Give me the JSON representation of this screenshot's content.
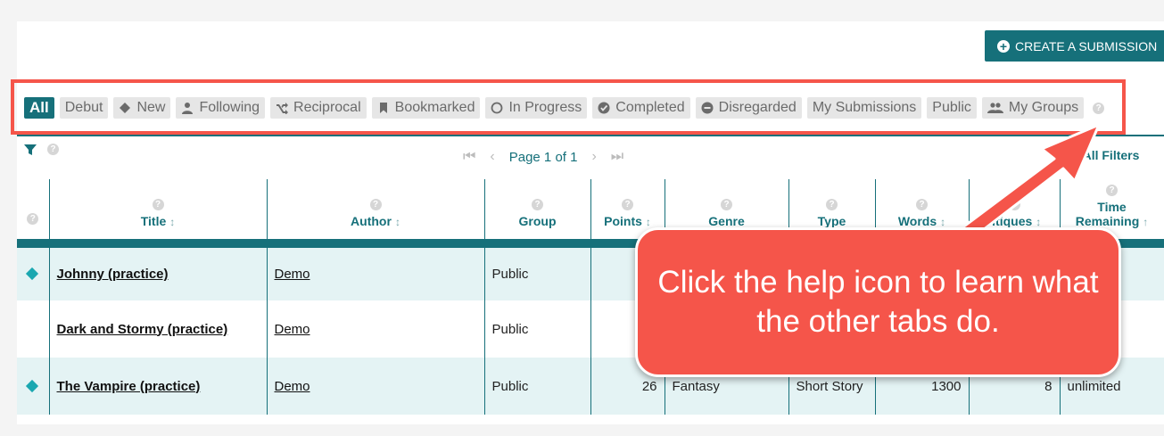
{
  "header": {
    "create_button_label": "CREATE A SUBMISSION"
  },
  "tabs": [
    {
      "label": "All",
      "icon": ""
    },
    {
      "label": "Debut",
      "icon": ""
    },
    {
      "label": "New",
      "icon": "diamond-icon"
    },
    {
      "label": "Following",
      "icon": "person-icon"
    },
    {
      "label": "Reciprocal",
      "icon": "shuffle-icon"
    },
    {
      "label": "Bookmarked",
      "icon": "bookmark-icon"
    },
    {
      "label": "In Progress",
      "icon": "circle-outline-icon"
    },
    {
      "label": "Completed",
      "icon": "check-circle-icon"
    },
    {
      "label": "Disregarded",
      "icon": "minus-circle-icon"
    },
    {
      "label": "My Submissions",
      "icon": ""
    },
    {
      "label": "Public",
      "icon": ""
    },
    {
      "label": "My Groups",
      "icon": "group-icon"
    }
  ],
  "help_glyph": "?",
  "pager": {
    "first": "⏮",
    "prev": "‹",
    "label": "Page 1 of 1",
    "next": "›",
    "last": "⏭"
  },
  "clear_filters": "ar All Filters",
  "columns": [
    "",
    "Title",
    "Author",
    "Group",
    "Points",
    "Genre",
    "Type",
    "Words",
    "Critiques",
    "Time Remaining"
  ],
  "column_labels_visible": {
    "genre": "Genre",
    "type": "Type",
    "words": "Words",
    "critiques": "ritiques",
    "time_remaining": "Time Remaining"
  },
  "rows": [
    {
      "marker": "diamond",
      "title": "Johnny (practice)",
      "author": "Demo",
      "group": "Public",
      "points": "",
      "genre": "",
      "type": "",
      "words": "",
      "critiques": "",
      "time": ""
    },
    {
      "marker": "",
      "title": "Dark and Stormy (practice)",
      "author": "Demo",
      "group": "Public",
      "points": "",
      "genre": "",
      "type": "",
      "words": "",
      "critiques": "",
      "time": ""
    },
    {
      "marker": "diamond",
      "title": "The Vampire (practice)",
      "author": "Demo",
      "group": "Public",
      "points": "26",
      "genre": "Fantasy",
      "type": "Short Story",
      "words": "1300",
      "critiques": "8",
      "time": "unlimited"
    }
  ],
  "callout": {
    "text": "Click the help icon to learn what the other tabs do."
  },
  "colors": {
    "teal": "#16707a",
    "callout_red": "#f5554a",
    "row_alt": "#e4f3f4"
  }
}
